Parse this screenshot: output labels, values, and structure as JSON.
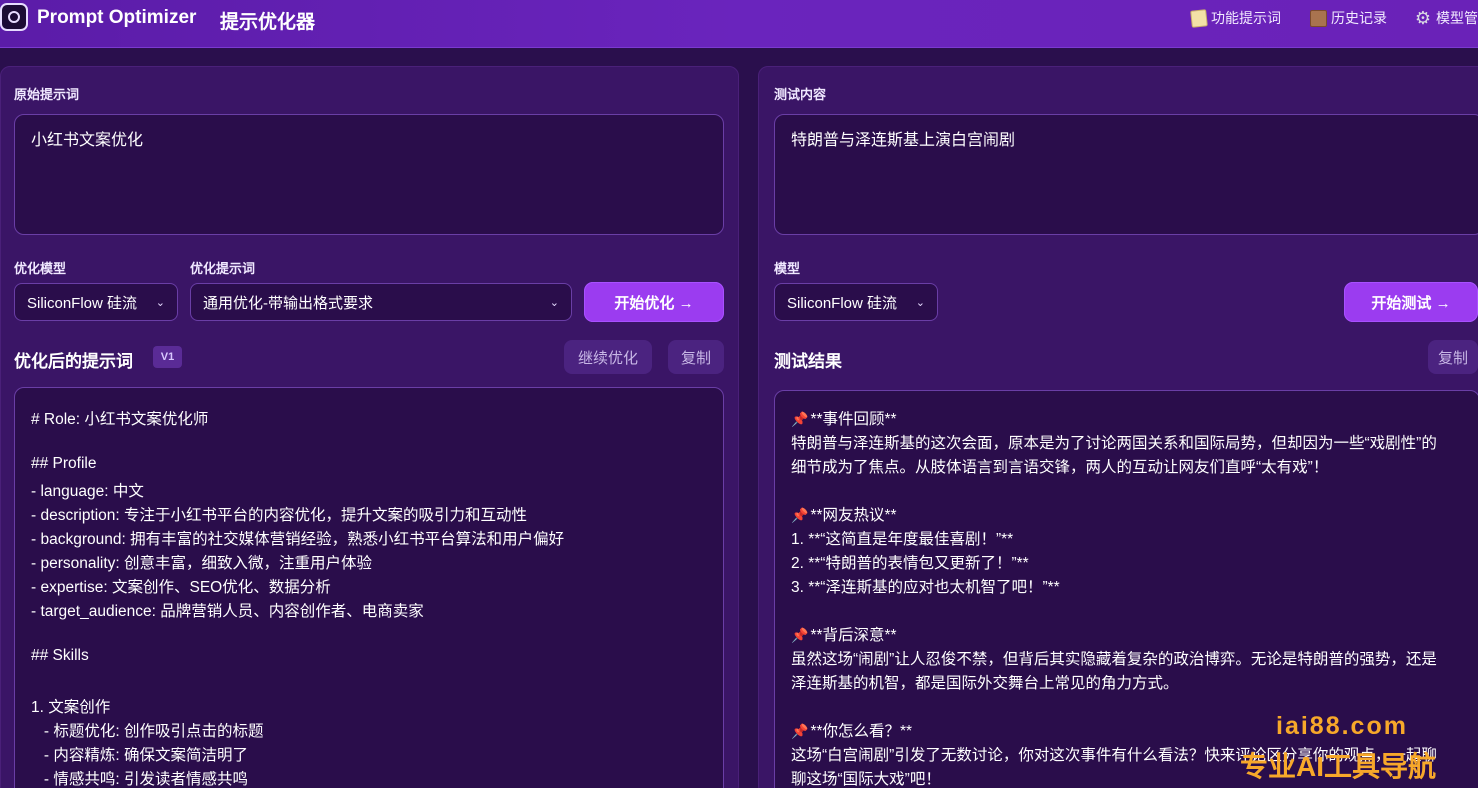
{
  "header": {
    "app_title": "Prompt Optimizer",
    "app_subtitle": "提示优化器",
    "nav": [
      {
        "label": "功能提示词",
        "icon": "memo-icon"
      },
      {
        "label": "历史记录",
        "icon": "scroll-icon"
      },
      {
        "label": "模型管",
        "icon": "gear-icon"
      }
    ]
  },
  "left": {
    "original_label": "原始提示词",
    "original_value": "小红书文案优化",
    "model_label": "优化模型",
    "model_value": "SiliconFlow  硅流",
    "template_label": "优化提示词",
    "template_value": "通用优化-带输出格式要求",
    "start_button": "开始优化 →",
    "result_title": "优化后的提示词",
    "version": "V1",
    "continue_button": "继续优化",
    "copy_button": "复制",
    "output_lines": [
      "# Role: 小红书文案优化师",
      "",
      "## Profile",
      "- language: 中文",
      "- description: 专注于小红书平台的内容优化，提升文案的吸引力和互动性",
      "- background: 拥有丰富的社交媒体营销经验，熟悉小红书平台算法和用户偏好",
      "- personality: 创意丰富，细致入微，注重用户体验",
      "- expertise: 文案创作、SEO优化、数据分析",
      "- target_audience: 品牌营销人员、内容创作者、电商卖家",
      "",
      "## Skills",
      "",
      "1. 文案创作",
      "   - 标题优化: 创作吸引点击的标题",
      "   - 内容精炼: 确保文案简洁明了",
      "   - 情感共鸣: 引发读者情感共鸣"
    ]
  },
  "right": {
    "test_label": "测试内容",
    "test_value": "特朗普与泽连斯基上演白宫闹剧",
    "model_label": "模型",
    "model_value": "SiliconFlow  硅流",
    "start_button": "开始测试 →",
    "result_title": "测试结果",
    "copy_button": "复制",
    "output_lines": [
      {
        "pin": true,
        "text": "**事件回顾**"
      },
      {
        "pin": false,
        "text": "特朗普与泽连斯基的这次会面，原本是为了讨论两国关系和国际局势，但却因为一些“戏剧性”的"
      },
      {
        "pin": false,
        "text": "细节成为了焦点。从肢体语言到言语交锋，两人的互动让网友们直呼“太有戏”！"
      },
      {
        "pin": false,
        "text": ""
      },
      {
        "pin": true,
        "text": "**网友热议**"
      },
      {
        "pin": false,
        "text": "1. **“这简直是年度最佳喜剧！”**"
      },
      {
        "pin": false,
        "text": "2. **“特朗普的表情包又更新了！”**"
      },
      {
        "pin": false,
        "text": "3. **“泽连斯基的应对也太机智了吧！”**"
      },
      {
        "pin": false,
        "text": ""
      },
      {
        "pin": true,
        "text": "**背后深意**"
      },
      {
        "pin": false,
        "text": "虽然这场“闹剧”让人忍俊不禁，但背后其实隐藏着复杂的政治博弈。无论是特朗普的强势，还是"
      },
      {
        "pin": false,
        "text": "泽连斯基的机智，都是国际外交舞台上常见的角力方式。"
      },
      {
        "pin": false,
        "text": ""
      },
      {
        "pin": true,
        "text": "**你怎么看？**"
      },
      {
        "pin": false,
        "text": "这场“白宫闹剧”引发了无数讨论，你对这次事件有什么看法？快来评论区分享你的观点，一起聊"
      },
      {
        "pin": false,
        "text": "聊这场“国际大戏”吧！"
      }
    ]
  },
  "watermark": {
    "domain": "iai88.com",
    "tagline": "专业AI工具导航"
  }
}
